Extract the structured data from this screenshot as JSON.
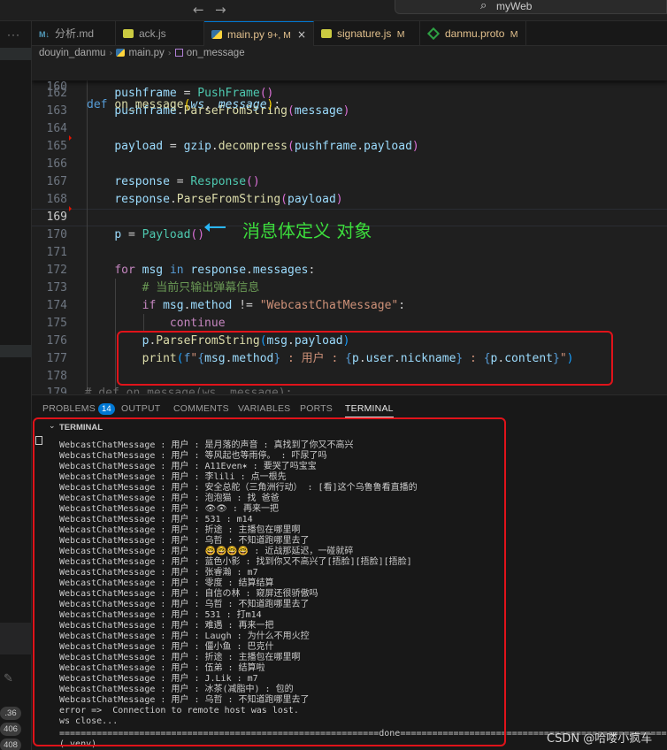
{
  "titlebar": {
    "search_text": "myWeb"
  },
  "tabs": [
    {
      "label": "分析.md",
      "icon": "markdown-icon",
      "modified": ""
    },
    {
      "label": "ack.js",
      "icon": "javascript-file-icon",
      "modified": ""
    },
    {
      "label": "main.py",
      "icon": "python-file-icon",
      "modified": "9+, M",
      "active": true
    },
    {
      "label": "signature.js",
      "icon": "javascript-file-icon",
      "modified": "M"
    },
    {
      "label": "danmu.proto",
      "icon": "proto-file-icon",
      "modified": "M"
    }
  ],
  "breadcrumb": {
    "folder": "douyin_danmu",
    "file": "main.py",
    "symbol": "on_message"
  },
  "editor": {
    "sticky_line": {
      "num": "160",
      "text": "def on_message(ws, message):"
    },
    "lines": [
      {
        "num": "162",
        "text": "    pushframe = PushFrame()"
      },
      {
        "num": "163",
        "text": "    pushframe.ParseFromString(message)"
      },
      {
        "num": "164",
        "text": ""
      },
      {
        "num": "165",
        "text": "    payload = gzip.decompress(pushframe.payload)"
      },
      {
        "num": "166",
        "text": ""
      },
      {
        "num": "167",
        "text": "    response = Response()"
      },
      {
        "num": "168",
        "text": "    response.ParseFromString(payload)"
      },
      {
        "num": "169",
        "text": ""
      },
      {
        "num": "170",
        "text": "    p = Payload()"
      },
      {
        "num": "171",
        "text": ""
      },
      {
        "num": "172",
        "text": "    for msg in response.messages:"
      },
      {
        "num": "173",
        "text": "        # 当前只输出弹幕信息"
      },
      {
        "num": "174",
        "text": "        if msg.method != \"WebcastChatMessage\":"
      },
      {
        "num": "175",
        "text": "            continue"
      },
      {
        "num": "176",
        "text": "        p.ParseFromString(msg.payload)"
      },
      {
        "num": "177",
        "text": "        print(f\"{msg.method} : 用户 : {p.user.nickname} : {p.content}\")"
      },
      {
        "num": "178",
        "text": ""
      }
    ],
    "folded_line": {
      "num": "179",
      "text": "  # def on_message(ws, message):…"
    },
    "annotation": "消息体定义 对象"
  },
  "panel": {
    "tabs": [
      "PROBLEMS",
      "OUTPUT",
      "COMMENTS",
      "VARIABLES",
      "PORTS",
      "TERMINAL"
    ],
    "problems_count": "14",
    "terminal_header": "TERMINAL"
  },
  "terminal": {
    "lines": [
      "WebcastChatMessage : 用户 : 是月落的声音 : 真找到了你又不高兴",
      "WebcastChatMessage : 用户 : 等风起也等雨停。 : 吓尿了吗",
      "WebcastChatMessage : 用户 : A11Even✶ : 要哭了吗宝宝",
      "WebcastChatMessage : 用户 : 李lili : 点一根先",
      "WebcastChatMessage : 用户 : 安全总舵（三角洲行动） : [看]这个乌鲁鲁看直播的",
      "WebcastChatMessage : 用户 : 泡泡猫 : 找 爸爸",
      "WebcastChatMessage : 用户 : 👁👁 : 再来一把",
      "WebcastChatMessage : 用户 : 531 : m14",
      "WebcastChatMessage : 用户 : 折途 : 主播包在哪里啊",
      "WebcastChatMessage : 用户 : 乌哲 : 不知道跑哪里去了",
      "WebcastChatMessage : 用户 : 🤓🤓🤓🤓 : 近战那延迟，一碰就碎",
      "WebcastChatMessage : 用户 : 蓝色小影 : 找到你又不高兴了[捂脸][捂脸][捂脸]",
      "WebcastChatMessage : 用户 : 张睿瀚 : m7",
      "WebcastChatMessage : 用户 : 零度 : 结算结算",
      "WebcastChatMessage : 用户 : 自信の林 : 窥屏还很骄傲吗",
      "WebcastChatMessage : 用户 : 乌哲 : 不知道跑哪里去了",
      "WebcastChatMessage : 用户 : 531 : 打m14",
      "WebcastChatMessage : 用户 : 难遇 : 再来一把",
      "WebcastChatMessage : 用户 : Laugh : 为什么不用火控",
      "WebcastChatMessage : 用户 : 僵小鱼 : 巴克什",
      "WebcastChatMessage : 用户 : 折途 : 主播包在哪里啊",
      "WebcastChatMessage : 用户 : 伍弟 : 结算啦",
      "WebcastChatMessage : 用户 : J.Lik : m7",
      "WebcastChatMessage : 用户 : 冰茶(减脂中) : 包的",
      "WebcastChatMessage : 用户 : 乌哲 : 不知道跑哪里去了",
      "error =>  Connection to remote host was lost.",
      "ws close..."
    ],
    "rule_label": "done",
    "prompt": "(.venv)"
  },
  "sidebar_counts": [
    ".36",
    "406",
    "408"
  ],
  "watermark": "CSDN @哈喽小疯车"
}
